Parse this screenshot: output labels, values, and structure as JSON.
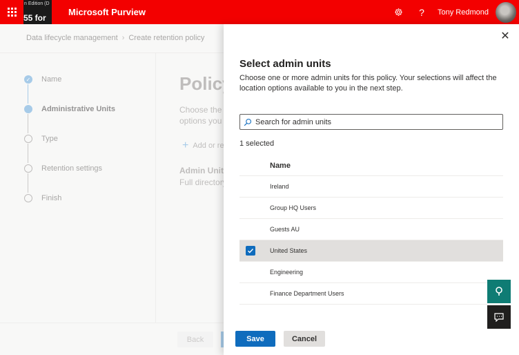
{
  "topbar": {
    "thumbnail_line1": "n Edition (D",
    "thumbnail_line2": "55 for",
    "app_name": "Microsoft Purview",
    "user_name": "Tony Redmond",
    "icons": [
      "waffle-icon",
      "settings-gear-icon",
      "help-question-icon"
    ],
    "accent_color": "#f30000"
  },
  "breadcrumb": {
    "items": [
      "Data lifecycle management",
      "Create retention policy"
    ],
    "separator": "›"
  },
  "wizard": {
    "steps": [
      {
        "label": "Name",
        "state": "completed"
      },
      {
        "label": "Administrative Units",
        "state": "current"
      },
      {
        "label": "Type",
        "state": "pending"
      },
      {
        "label": "Retention settings",
        "state": "pending"
      },
      {
        "label": "Finish",
        "state": "pending"
      }
    ]
  },
  "main": {
    "title": "Policy",
    "desc_line1": "Choose the a",
    "desc_line2": "options you",
    "add_label": "Add or re",
    "section_heading": "Admin Units",
    "section_value": "Full directory",
    "back_label": "Back"
  },
  "panel": {
    "title": "Select admin units",
    "description": "Choose one or more admin units for this policy. Your selections will affect the location options available to you in the next step.",
    "search_placeholder": "Search for admin units",
    "selected_count": "1 selected",
    "column_header": "Name",
    "rows": [
      {
        "name": "Ireland",
        "selected": false
      },
      {
        "name": "Group HQ Users",
        "selected": false
      },
      {
        "name": "Guests AU",
        "selected": false
      },
      {
        "name": "United States",
        "selected": true
      },
      {
        "name": "Engineering",
        "selected": false
      },
      {
        "name": "Finance Department Users",
        "selected": false
      }
    ],
    "save_label": "Save",
    "cancel_label": "Cancel",
    "primary_color": "#0f6cbd"
  }
}
